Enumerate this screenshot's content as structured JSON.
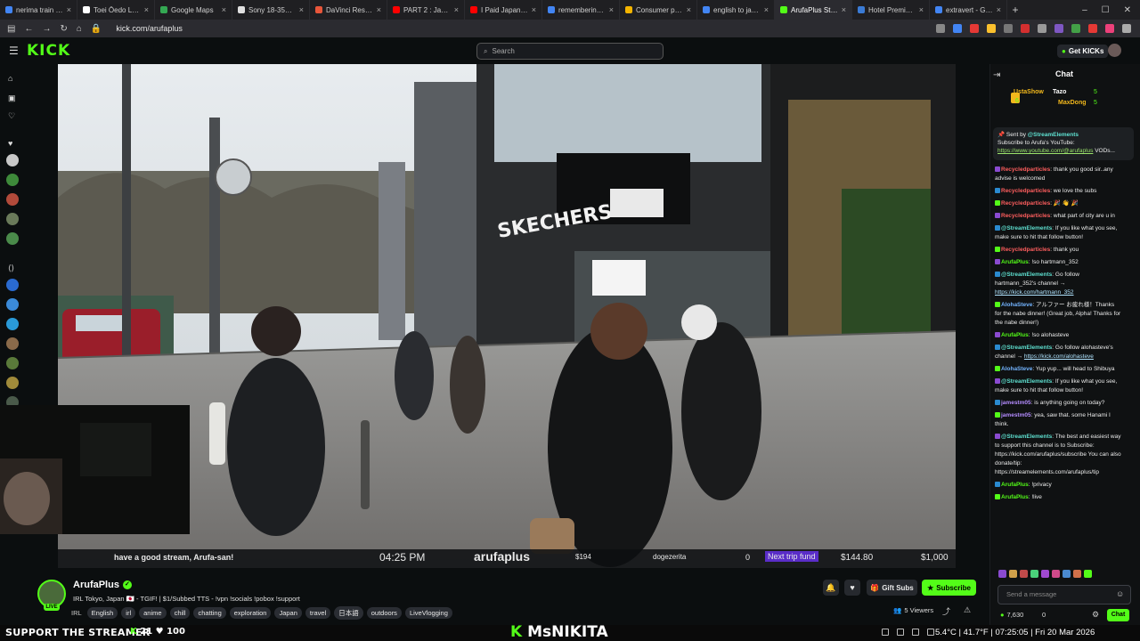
{
  "browser": {
    "tabs": [
      {
        "title": "nerima train line map",
        "color": "#4285f4"
      },
      {
        "title": "Toei Ōedo Line - Wiki",
        "color": "#ffffff"
      },
      {
        "title": "Google Maps",
        "color": "#34a853"
      },
      {
        "title": "Sony 18-35mm GM Le",
        "color": "#e0e0e0"
      },
      {
        "title": "DaVinci Resolve — M",
        "color": "#e8563a"
      },
      {
        "title": "PART 2 : Japan is curr",
        "color": "#ff0000"
      },
      {
        "title": "I Paid Japanese Peopl",
        "color": "#ff0000"
      },
      {
        "title": "remembering kanji - G",
        "color": "#4285f4"
      },
      {
        "title": "Consumer price inflati",
        "color": "#f4b400"
      },
      {
        "title": "english to japanese -",
        "color": "#4285f4"
      },
      {
        "title": "ArufaPlus Stream",
        "color": "#53fc18",
        "active": true
      },
      {
        "title": "Hotel Premium Green",
        "color": "#3a7bd5"
      },
      {
        "title": "extravert - Google Se",
        "color": "#4285f4"
      }
    ],
    "url": "kick.com/arufaplus"
  },
  "header": {
    "logo": "KICK",
    "search_placeholder": "Search",
    "get_kicks": "Get KICKs"
  },
  "video": {
    "overlay_message": "have a good stream, Arufa-san!",
    "time": "04:25 PM",
    "brand": "arufaplus",
    "counter": "$194",
    "cheer": "dogezerita",
    "zero": "0",
    "trip_label": "Next trip fund",
    "trip_current": "$144.80",
    "trip_goal": "$1,000"
  },
  "channel": {
    "name": "ArufaPlus",
    "live_label": "LIVE",
    "stream_title": "IRL Tokyo, Japan 🇯🇵 - TGIF! | $1/Subbed TTS - !vpn !socials !pobox !support",
    "category": "IRL",
    "tags": [
      "English",
      "irl",
      "anime",
      "chill",
      "chatting",
      "exploration",
      "Japan",
      "travel",
      "日本語",
      "outdoors",
      "LiveVlogging"
    ],
    "gift_subs": "Gift Subs",
    "subscribe": "Subscribe",
    "viewers": "5 Viewers"
  },
  "chat": {
    "title": "Chat",
    "leaderboard": [
      {
        "name": "UstaShow",
        "count": "6"
      },
      {
        "name": "Tazo",
        "count": "5"
      },
      {
        "name": "MaxDong",
        "count": "5"
      }
    ],
    "pinned_sent_by": "Sent by",
    "pinned_author": "@StreamElements",
    "pinned_text": "Subscribe to Arufa's YouTube:",
    "pinned_link": "https://www.youtube.com/@arufaplus",
    "pinned_suffix": "VODs...",
    "messages": [
      {
        "user": "Recycledparticles",
        "cls": "u-red",
        "text": "thank you good sir..any advise is welcomed"
      },
      {
        "user": "Recycledparticles",
        "cls": "u-red",
        "text": "we love the subs"
      },
      {
        "user": "Recycledparticles",
        "cls": "u-red",
        "text": "🎉 👋 🎉"
      },
      {
        "user": "Recycledparticles",
        "cls": "u-red",
        "text": "what part of city are u in"
      },
      {
        "user": "@StreamElements",
        "cls": "u-cya",
        "text": "If you like what you see, make sure to hit that follow button!"
      },
      {
        "user": "Recycledparticles",
        "cls": "u-red",
        "text": "thank you"
      },
      {
        "user": "ArufaPlus",
        "cls": "u-grn",
        "text": "!so hartmann_352"
      },
      {
        "user": "@StreamElements",
        "cls": "u-cya",
        "text": "Go follow hartmann_352's channel → ",
        "link": "https://kick.com/hartmann_352"
      },
      {
        "user": "AlohaSteve",
        "cls": "u-blu",
        "text": "アルファー お疲れ様！Thanks for the nabe dinner! (Great job, Alpha! Thanks for the nabe dinner!)"
      },
      {
        "user": "ArufaPlus",
        "cls": "u-grn",
        "text": "!so alohasteve"
      },
      {
        "user": "@StreamElements",
        "cls": "u-cya",
        "text": "Go follow alohasteve's channel → ",
        "link": "https://kick.com/alohasteve"
      },
      {
        "user": "AlohaSteve",
        "cls": "u-blu",
        "text": "Yup yup... will head to Shibuya"
      },
      {
        "user": "@StreamElements",
        "cls": "u-cya",
        "text": "If you like what you see, make sure to hit that follow button!"
      },
      {
        "user": "jamestm05",
        "cls": "u-pur",
        "text": "is anything going on today?"
      },
      {
        "user": "jamestm05",
        "cls": "u-pur",
        "text": "yea, saw that. some Hanami I think."
      },
      {
        "user": "@StreamElements",
        "cls": "u-cya",
        "text": "The best and easiest way to support this channel is to Subscribe: https://kick.com/arufaplus/subscribe You can also donate/tip: https://streamelements.com/arufaplus/tip"
      },
      {
        "user": "ArufaPlus",
        "cls": "u-grn",
        "text": "!privacy"
      },
      {
        "user": "ArufaPlus",
        "cls": "u-grn",
        "text": "!live"
      }
    ],
    "input_placeholder": "Send a message",
    "kicks_balance": "7,630",
    "count": "0",
    "send": "Chat"
  },
  "bottom": {
    "support": "SUPPORT THE STREAMER",
    "support_a": "21",
    "support_b": "100",
    "brand_k": "K",
    "brand_name": "MsNIKITA",
    "sysinfo": "5.4°C | 41.7°F | 07:25:05 | Fri 20 Mar 2026"
  },
  "colors": {
    "kick_green": "#53fc18",
    "bg": "#0b0e0f"
  }
}
